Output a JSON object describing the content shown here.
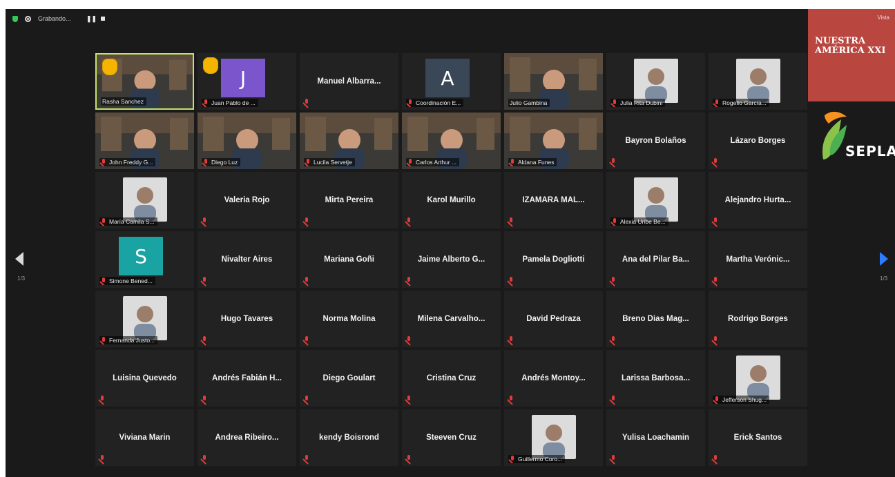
{
  "recording": {
    "status_text": "Grabando...",
    "pause_icon": "pause-icon",
    "stop_icon": "stop-icon"
  },
  "pagination": {
    "left": "1/3",
    "right": "1/3"
  },
  "branding": {
    "title": "NUESTRA AMÉRICA XXI",
    "view_label": "Vista",
    "logo_text": "SEPLA",
    "brand_color": "#b9463f"
  },
  "tiles": [
    {
      "name": "Rasha Sanchez",
      "type": "video",
      "active": true,
      "hand_raised": true,
      "muted": false
    },
    {
      "name": "Juan Pablo de ...",
      "type": "avatar",
      "initial": "J",
      "avatar_color": "#7b55cc",
      "hand_raised": true,
      "muted": true
    },
    {
      "name": "Manuel Albarra...",
      "type": "name",
      "muted": true
    },
    {
      "name": "Coordinación E...",
      "type": "avatar",
      "initial": "A",
      "avatar_color": "#3a4756",
      "muted": true
    },
    {
      "name": "Julio Gambina",
      "type": "video",
      "muted": false
    },
    {
      "name": "Julia Rita Dubini",
      "type": "photo",
      "muted": true
    },
    {
      "name": "Rogelio García...",
      "type": "photo",
      "muted": true
    },
    {
      "name": "John Freddy G...",
      "type": "video",
      "muted": true
    },
    {
      "name": "Diego Luz",
      "type": "video",
      "muted": true
    },
    {
      "name": "Lucila Servetje",
      "type": "video",
      "muted": true
    },
    {
      "name": "Carlos Arthur ...",
      "type": "video",
      "muted": true
    },
    {
      "name": "Aldana Funes",
      "type": "video",
      "muted": true
    },
    {
      "name": "Bayron Bolaños",
      "type": "name",
      "muted": true
    },
    {
      "name": "Lázaro Borges",
      "type": "name",
      "muted": true
    },
    {
      "name": "María Camila S...",
      "type": "photo",
      "muted": true
    },
    {
      "name": "Valeria Rojo",
      "type": "name",
      "muted": true
    },
    {
      "name": "Mirta Pereira",
      "type": "name",
      "muted": true
    },
    {
      "name": "Karol Murillo",
      "type": "name",
      "muted": true
    },
    {
      "name": "IZAMARA MAL...",
      "type": "name",
      "muted": true
    },
    {
      "name": "Alexia Uribe Be...",
      "type": "photo",
      "muted": true
    },
    {
      "name": "Alejandro Hurta...",
      "type": "name",
      "muted": true
    },
    {
      "name": "Simone Bened...",
      "type": "avatar",
      "initial": "S",
      "avatar_color": "#1aa3a3",
      "muted": true
    },
    {
      "name": "Nivalter Aires",
      "type": "name",
      "muted": true
    },
    {
      "name": "Mariana Goñi",
      "type": "name",
      "muted": true
    },
    {
      "name": "Jaime Alberto G...",
      "type": "name",
      "muted": true
    },
    {
      "name": "Pamela Dogliotti",
      "type": "name",
      "muted": true
    },
    {
      "name": "Ana del Pilar Ba...",
      "type": "name",
      "muted": true
    },
    {
      "name": "Martha Verónic...",
      "type": "name",
      "muted": true
    },
    {
      "name": "Fernanda Justo...",
      "type": "photo",
      "muted": true
    },
    {
      "name": "Hugo Tavares",
      "type": "name",
      "muted": true
    },
    {
      "name": "Norma Molina",
      "type": "name",
      "muted": true
    },
    {
      "name": "Milena Carvalho...",
      "type": "name",
      "muted": true
    },
    {
      "name": "David Pedraza",
      "type": "name",
      "muted": true
    },
    {
      "name": "Breno Dias Mag...",
      "type": "name",
      "muted": true
    },
    {
      "name": "Rodrigo Borges",
      "type": "name",
      "muted": true
    },
    {
      "name": "Luisina Quevedo",
      "type": "name",
      "muted": true
    },
    {
      "name": "Andrés Fabián H...",
      "type": "name",
      "muted": true
    },
    {
      "name": "Diego Goulart",
      "type": "name",
      "muted": true
    },
    {
      "name": "Cristina Cruz",
      "type": "name",
      "muted": true
    },
    {
      "name": "Andrés Montoy...",
      "type": "name",
      "muted": true
    },
    {
      "name": "Larissa Barbosa...",
      "type": "name",
      "muted": true
    },
    {
      "name": "Jefferson Shug...",
      "type": "photo",
      "muted": true
    },
    {
      "name": "Viviana Marin",
      "type": "name",
      "muted": true
    },
    {
      "name": "Andrea Ribeiro...",
      "type": "name",
      "muted": true
    },
    {
      "name": "kendy Boisrond",
      "type": "name",
      "muted": true
    },
    {
      "name": "Steeven Cruz",
      "type": "name",
      "muted": true
    },
    {
      "name": "Guillermo Coro...",
      "type": "photo",
      "muted": true
    },
    {
      "name": "Yulisa Loachamin",
      "type": "name",
      "muted": true
    },
    {
      "name": "Erick Santos",
      "type": "name",
      "muted": true
    }
  ]
}
